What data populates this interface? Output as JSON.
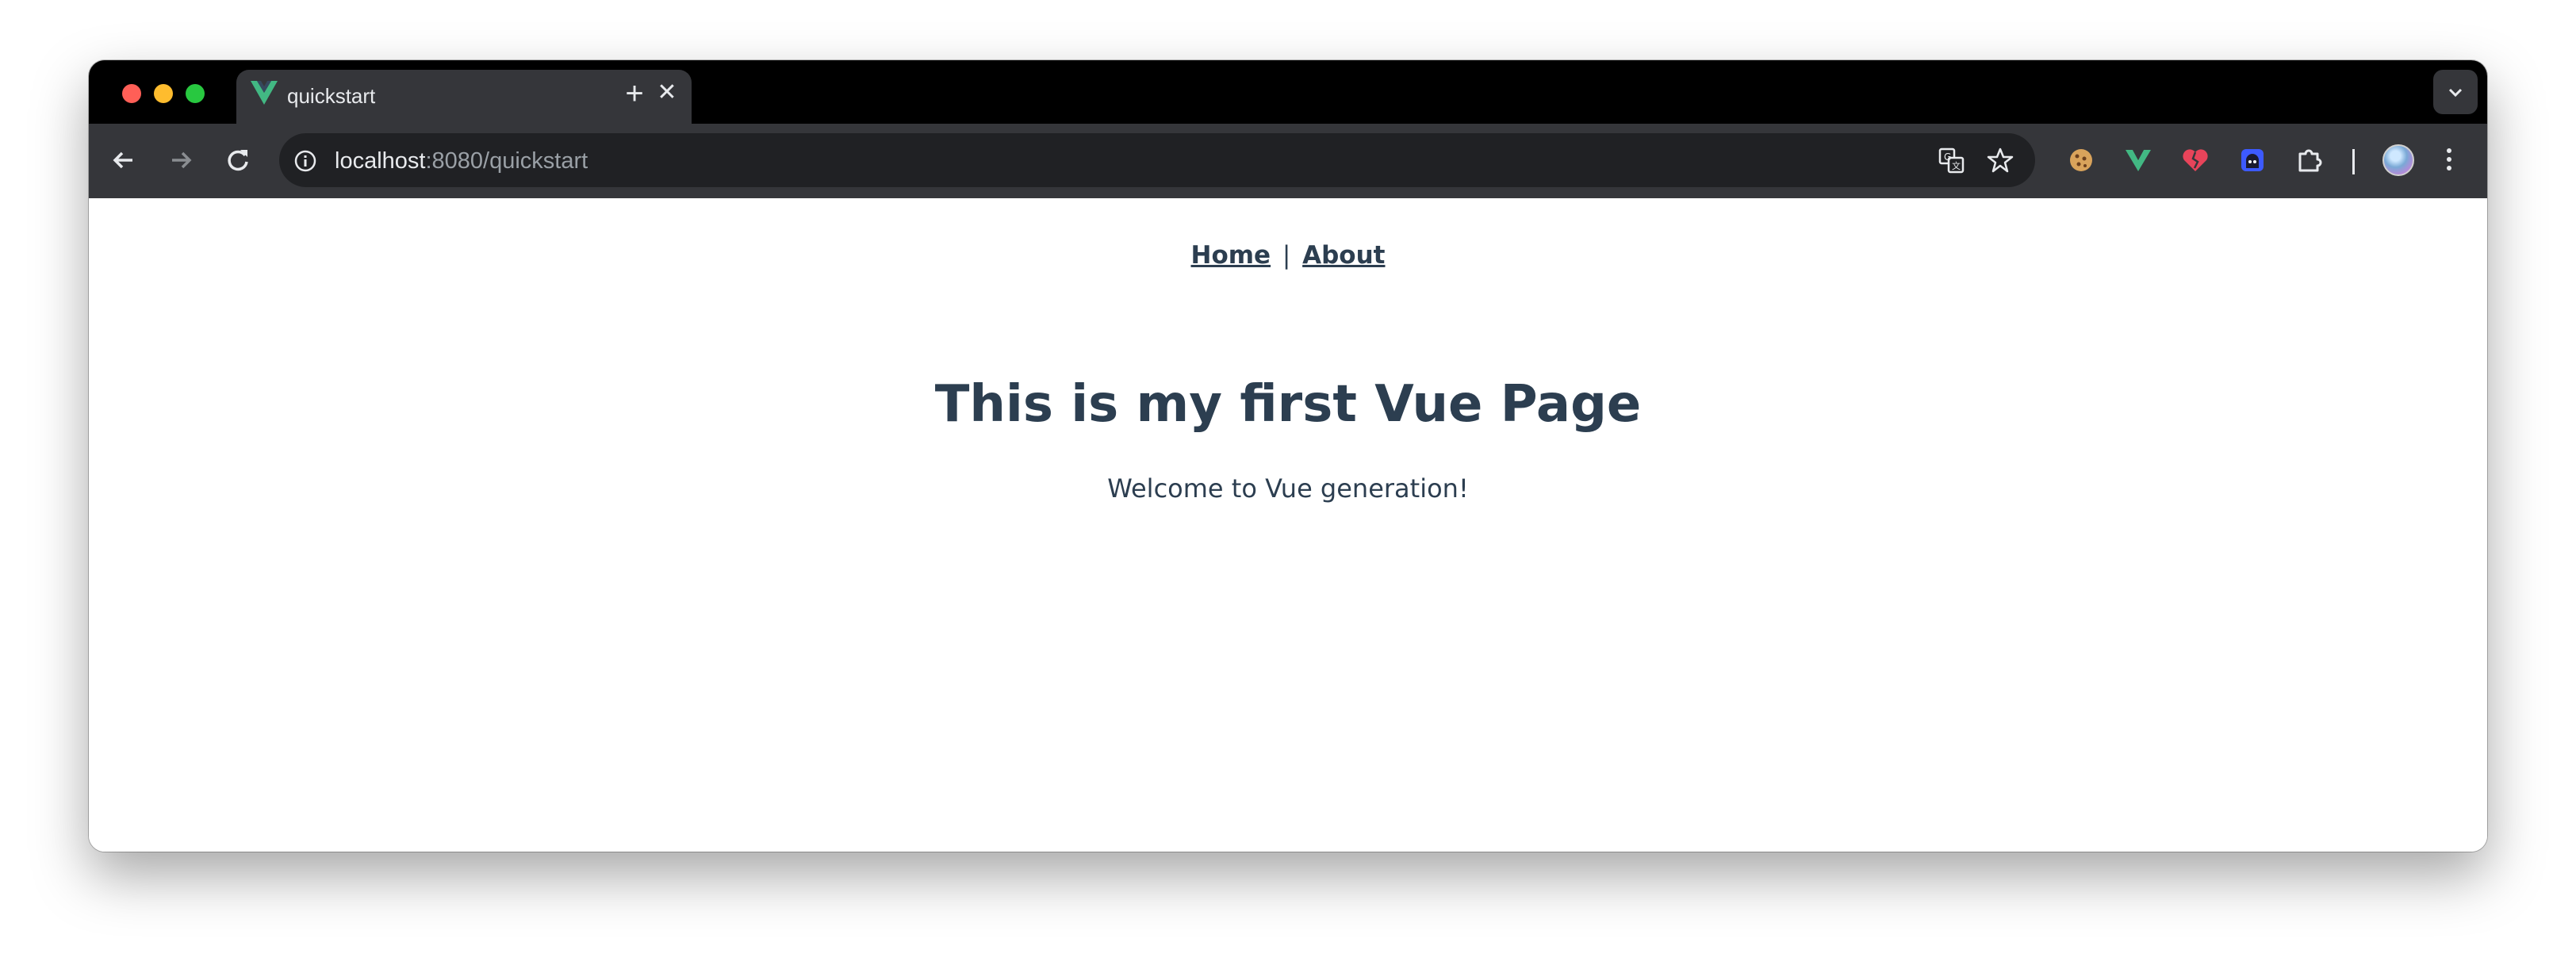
{
  "browser": {
    "tab": {
      "title": "quickstart",
      "close_glyph": "✕"
    },
    "new_tab_glyph": "+",
    "address_bar": {
      "host": "localhost",
      "rest": ":8080/quickstart"
    },
    "extensions": [
      "cookie-icon",
      "vue-devtools-icon",
      "broken-heart-icon",
      "ghost-extension-icon",
      "puzzle-icon"
    ],
    "colors": {
      "vue_green": "#42b883",
      "vue_dark": "#35495e",
      "tab_bg": "#35363a",
      "omnibox_bg": "#202124"
    }
  },
  "page": {
    "nav": {
      "home": "Home",
      "separator": "|",
      "about": "About"
    },
    "heading": "This is my first Vue Page",
    "subtitle": "Welcome to Vue generation!",
    "text_color": "#2c3e50"
  }
}
